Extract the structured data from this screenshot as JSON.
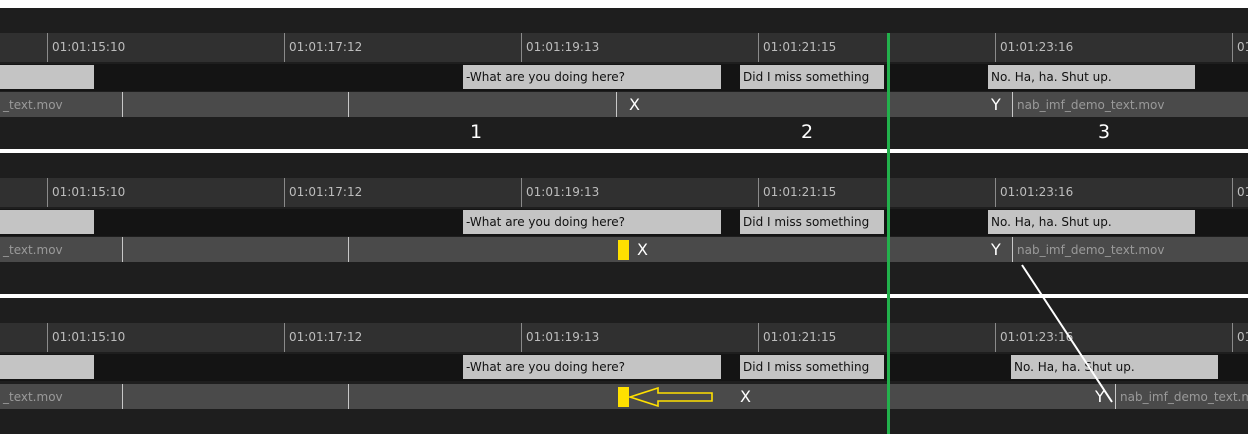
{
  "timecodes": [
    "01:01:15:10",
    "01:01:17:12",
    "01:01:19:13",
    "01:01:21:15",
    "01:01:23:16",
    "01:"
  ],
  "subtitles": [
    "-What are you doing here?",
    "Did I miss something",
    "No. Ha, ha. Shut up."
  ],
  "clip_left_label": "_text.mov",
  "clip_right_label": "nab_imf_demo_text.mov",
  "marker_x": "X",
  "marker_y": "Y",
  "section_numbers": [
    "1",
    "2",
    "3"
  ],
  "colors": {
    "playhead": "#22b14c",
    "highlight": "#ffe000",
    "subtitle_clip": "#c4c4c4"
  },
  "icons": [
    "left-arrow-icon"
  ]
}
